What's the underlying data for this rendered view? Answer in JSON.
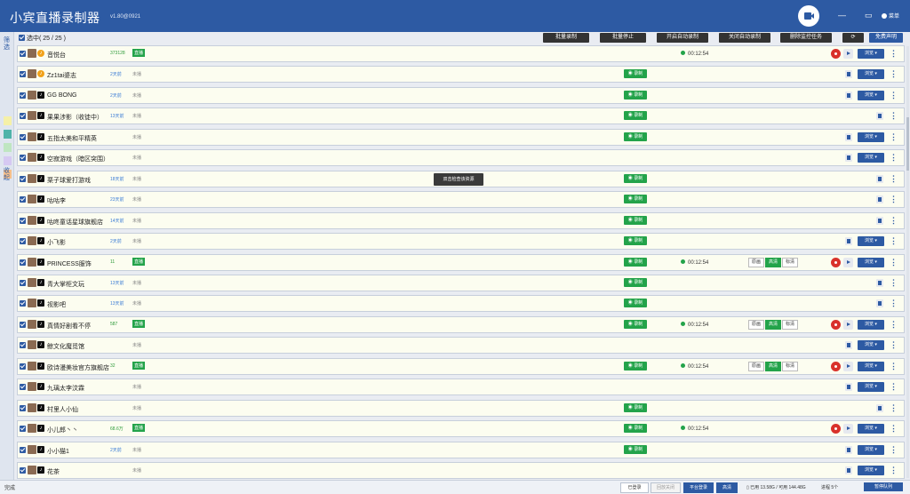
{
  "app": {
    "title": "小宾直播录制器",
    "version": "v1.80@0921",
    "menu_label": "菜单",
    "icons": {
      "minimize": "minimize-icon",
      "folder": "folder-icon",
      "close": "close-icon",
      "record": "camera-record-icon"
    }
  },
  "sidebar": {
    "top_text": "筛选",
    "bottom_text": "收起",
    "swatches": [
      "#f5f0a8",
      "#4fb3a9",
      "#bfe6c1",
      "#d6c9f2",
      "#f7c08a"
    ]
  },
  "toolbar": {
    "selected": "选中( 25 / 25 )",
    "buttons": [
      "批量录制",
      "批量停止",
      "开启自动录制",
      "关闭自动录制",
      "删除监控任务"
    ],
    "refresh_icon": "refresh-icon",
    "free_label": "免费声明"
  },
  "labels": {
    "record": "录制",
    "browse": "浏览 ▾",
    "live": "直播",
    "not_live": "未播",
    "quality": [
      "原画",
      "高清",
      "标清"
    ]
  },
  "colors": {
    "accent": "#2d5aa3",
    "live": "#23a34a",
    "danger": "#d9312b"
  },
  "rows": [
    {
      "name": "音悦台",
      "plat": "orange",
      "fans": "373128",
      "status": "live",
      "record": false,
      "timer": "00:12:54",
      "quality": null,
      "warn": true,
      "play": true,
      "trash": false,
      "browse": true
    },
    {
      "name": "Zz1tai婆志",
      "plat": "orange",
      "fans": "2天前",
      "status": "off",
      "record": true,
      "timer": null,
      "quality": null,
      "warn": false,
      "play": false,
      "trash": true,
      "browse": true
    },
    {
      "name": "GG BONG",
      "plat": "dy",
      "fans": "2天前",
      "status": "off",
      "record": true,
      "timer": null,
      "quality": null,
      "warn": false,
      "play": false,
      "trash": true,
      "browse": true
    },
    {
      "name": "果果涉影（收徒中）",
      "plat": "dy",
      "fans": "13天前",
      "status": "off",
      "record": true,
      "timer": null,
      "quality": null,
      "warn": false,
      "play": false,
      "trash": true,
      "browse": false
    },
    {
      "name": "五指太美和平精英",
      "plat": "dy",
      "fans": "",
      "status": "off",
      "record": true,
      "timer": null,
      "quality": null,
      "warn": false,
      "play": false,
      "trash": true,
      "browse": true
    },
    {
      "name": "空寂游戏（暗区突围）",
      "plat": "dy",
      "fans": "",
      "status": "off",
      "record": false,
      "timer": null,
      "quality": null,
      "warn": false,
      "play": false,
      "trash": true,
      "browse": true
    },
    {
      "name": "栗子球爱打游戏",
      "plat": "dy",
      "fans": "18天前",
      "status": "off",
      "record": true,
      "timer": null,
      "quality": null,
      "warn": false,
      "play": false,
      "trash": true,
      "browse": false
    },
    {
      "name": "咕咕李",
      "plat": "dy",
      "fans": "23天前",
      "status": "off",
      "record": true,
      "timer": null,
      "quality": null,
      "warn": false,
      "play": false,
      "trash": true,
      "browse": false
    },
    {
      "name": "咕咚童话星球旗舰店",
      "plat": "dy",
      "fans": "14天前",
      "status": "off",
      "record": true,
      "timer": null,
      "quality": null,
      "warn": false,
      "play": false,
      "trash": true,
      "browse": false
    },
    {
      "name": "小飞影",
      "plat": "dy",
      "fans": "2天前",
      "status": "off",
      "record": true,
      "timer": null,
      "quality": null,
      "warn": false,
      "play": false,
      "trash": true,
      "browse": true
    },
    {
      "name": "PRINCESS服饰",
      "plat": "dy",
      "fans": "11",
      "status": "live",
      "record": true,
      "timer": "00:12:54",
      "quality": "高清",
      "warn": true,
      "play": true,
      "trash": false,
      "browse": true
    },
    {
      "name": "青大掌柜文玩",
      "plat": "dy",
      "fans": "13天前",
      "status": "off",
      "record": true,
      "timer": null,
      "quality": null,
      "warn": false,
      "play": false,
      "trash": true,
      "browse": false
    },
    {
      "name": "视影吧",
      "plat": "dy",
      "fans": "13天前",
      "status": "off",
      "record": true,
      "timer": null,
      "quality": null,
      "warn": false,
      "play": false,
      "trash": true,
      "browse": false
    },
    {
      "name": "真情好剧看不停",
      "plat": "dy",
      "fans": "587",
      "status": "live",
      "record": true,
      "timer": "00:12:54",
      "quality": "高清",
      "warn": true,
      "play": true,
      "trash": false,
      "browse": true
    },
    {
      "name": "鲸文化魔觅馆",
      "plat": "dy",
      "fans": "",
      "status": "off",
      "record": false,
      "timer": null,
      "quality": null,
      "warn": false,
      "play": false,
      "trash": true,
      "browse": true
    },
    {
      "name": "欧诗漫美妆官方旗舰店",
      "plat": "dy",
      "fans": "32",
      "status": "live",
      "record": true,
      "timer": "00:12:54",
      "quality": "高清",
      "warn": true,
      "play": true,
      "trash": false,
      "browse": true
    },
    {
      "name": "九璃太李汶霖",
      "plat": "dy",
      "fans": "",
      "status": "off",
      "record": false,
      "timer": null,
      "quality": null,
      "warn": false,
      "play": false,
      "trash": true,
      "browse": true
    },
    {
      "name": "村里人小仙",
      "plat": "dy",
      "fans": "",
      "status": "off",
      "record": true,
      "timer": null,
      "quality": null,
      "warn": false,
      "play": false,
      "trash": true,
      "browse": false
    },
    {
      "name": "小儿郎丶丶",
      "plat": "dy",
      "fans": "68.6万",
      "status": "live",
      "record": true,
      "timer": "00:12:54",
      "quality": null,
      "warn": true,
      "play": true,
      "trash": false,
      "browse": true
    },
    {
      "name": "小小猫1",
      "plat": "dy",
      "fans": "2天前",
      "status": "off",
      "record": true,
      "timer": null,
      "quality": null,
      "warn": false,
      "play": false,
      "trash": true,
      "browse": true
    },
    {
      "name": "花茶",
      "plat": "dy",
      "fans": "",
      "status": "off",
      "record": false,
      "timer": null,
      "quality": null,
      "warn": false,
      "play": false,
      "trash": true,
      "browse": true
    }
  ],
  "tooltip": "双击检查该资源",
  "statusbar": {
    "done": "完成",
    "buttons": [
      "已登录",
      "回放关闭",
      "平台登录",
      "高清"
    ],
    "disk": "已用 13.58G / 可用 144.48G",
    "progress": "进程 5个",
    "tasks": "暂停队列"
  }
}
